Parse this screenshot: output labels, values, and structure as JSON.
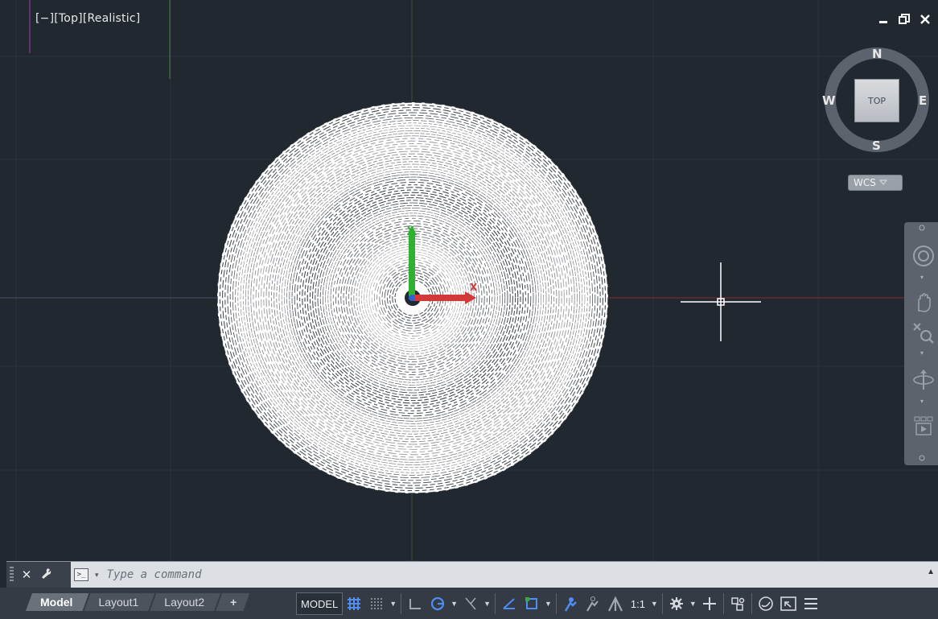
{
  "viewport": {
    "label_parts": [
      "[−]",
      "[Top]",
      "[Realistic]"
    ],
    "window_controls": [
      "minimize-icon",
      "restore-icon",
      "close-icon"
    ]
  },
  "viewcube": {
    "north": "N",
    "south": "S",
    "east": "E",
    "west": "W",
    "top_face": "TOP",
    "wcs_label": "WCS"
  },
  "ucs": {
    "x_label": "X",
    "y_label": "Y"
  },
  "navbar": {
    "items": [
      "steering-wheel-icon",
      "pan-icon",
      "zoom-icon",
      "orbit-icon",
      "showmotion-icon"
    ]
  },
  "command_line": {
    "placeholder": "Type a command"
  },
  "layout_tabs": [
    {
      "label": "Model",
      "active": true
    },
    {
      "label": "Layout1",
      "active": false
    },
    {
      "label": "Layout2",
      "active": false
    },
    {
      "label": "+",
      "active": false
    }
  ],
  "status": {
    "model_button": "MODEL",
    "annotation_scale": "1:1"
  },
  "colors": {
    "background": "#212830",
    "axis_x": "#d23a3a",
    "axis_y": "#2fb02f"
  }
}
